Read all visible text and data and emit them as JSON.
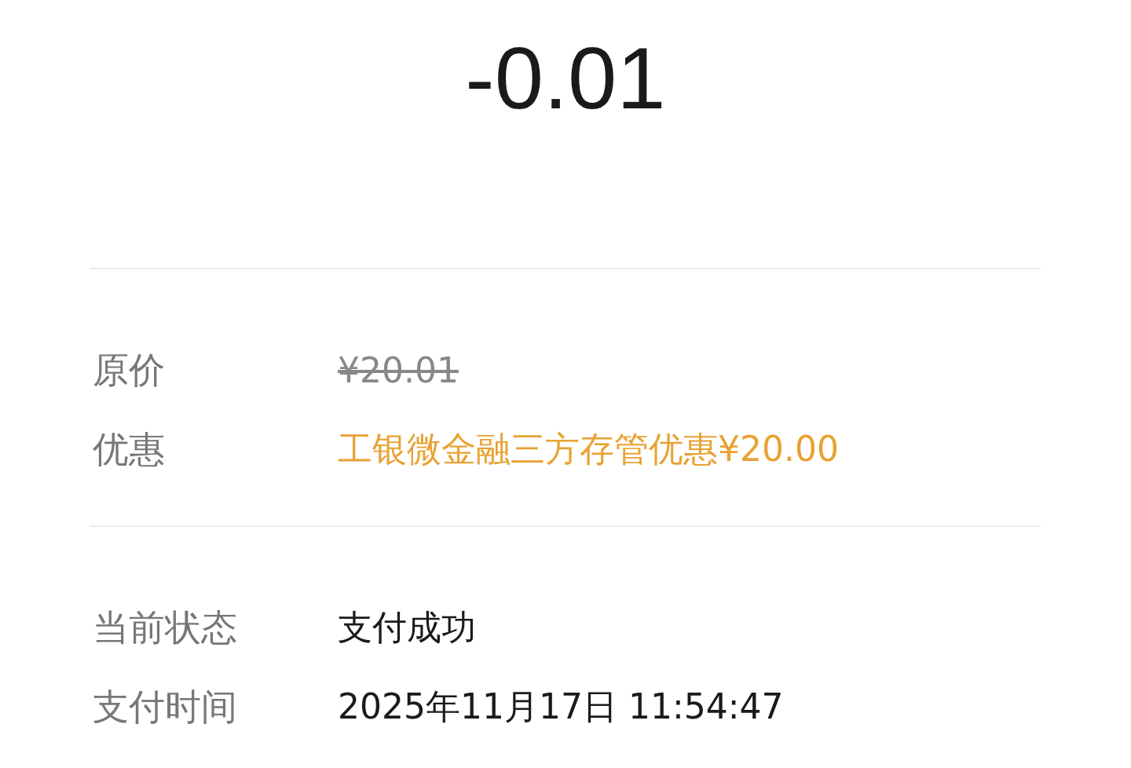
{
  "amount": "-0.01",
  "sections": [
    {
      "rows": [
        {
          "label": "原价",
          "value": "¥20.01",
          "kind": "struck"
        },
        {
          "label": "优惠",
          "value": "工银微金融三方存管优惠¥20.00",
          "kind": "discount"
        }
      ]
    },
    {
      "rows": [
        {
          "label": "当前状态",
          "value": "支付成功",
          "kind": "plain"
        },
        {
          "label": "支付时间",
          "value": "2025年11月17日 11:54:47",
          "kind": "plain"
        }
      ]
    }
  ]
}
